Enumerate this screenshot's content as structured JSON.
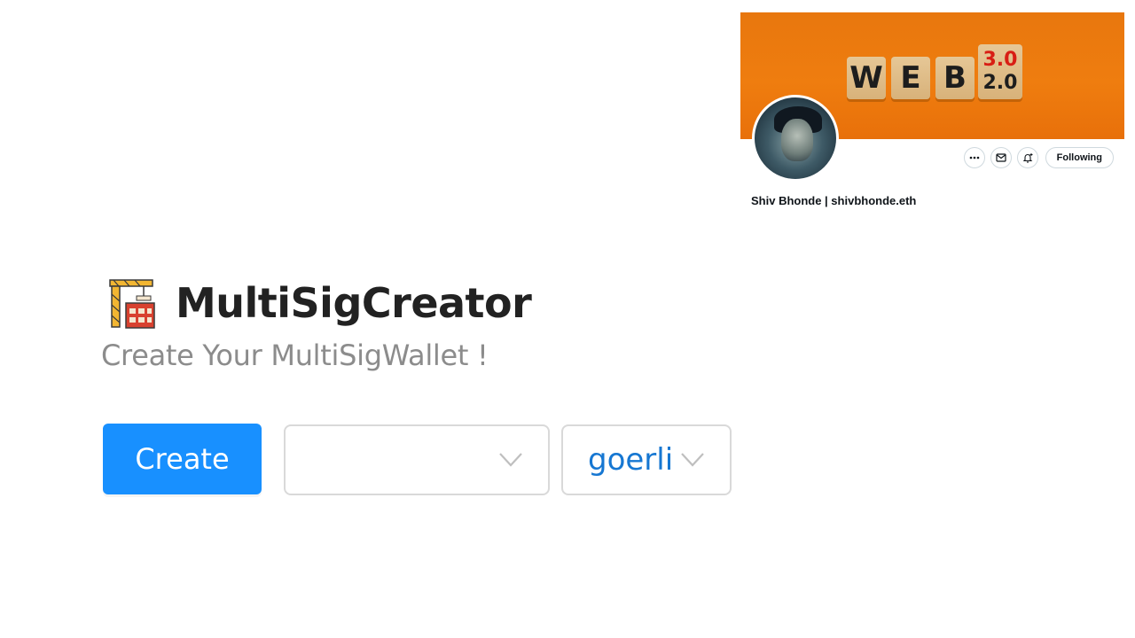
{
  "profile_card": {
    "banner": {
      "cube_letters": [
        "W",
        "E",
        "B"
      ],
      "version_new": "3.0",
      "version_old": "2.0"
    },
    "following_label": "Following",
    "name": "Shiv Bhonde | shivbhonde.eth",
    "action_icons": [
      "more-icon",
      "message-icon",
      "notification-bell-icon"
    ]
  },
  "app": {
    "title": "MultiSigCreator",
    "title_icon": "construction-crane-icon",
    "subtitle": "Create Your MultiSigWallet !",
    "create_label": "Create",
    "wallet_select": {
      "value": ""
    },
    "network_select": {
      "value": "goerli"
    }
  },
  "colors": {
    "primary": "#1890ff",
    "banner_orange": "#ef7d0f",
    "network_text": "#1677d2",
    "subtitle": "#8c8c8c"
  }
}
